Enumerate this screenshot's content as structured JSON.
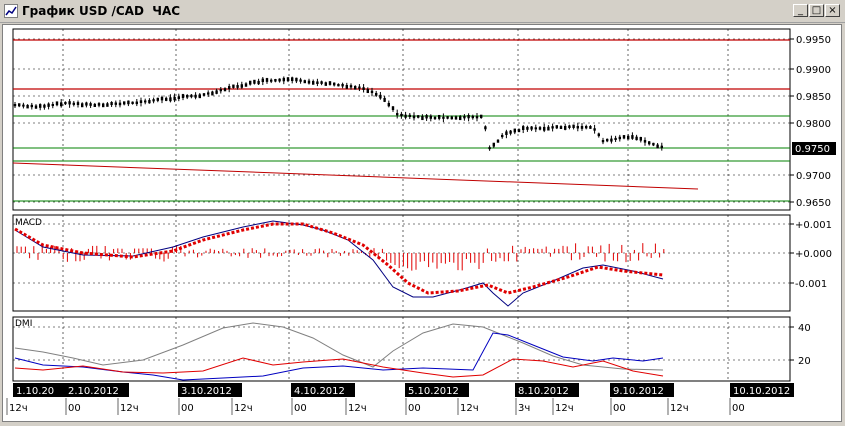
{
  "window": {
    "title": "График USD /CAD  ЧАС",
    "minimize_label": "_",
    "maximize_label": "□",
    "close_label": "×"
  },
  "price_panel": {
    "price_labels": [
      "0.9950",
      "0.9900",
      "0.9850",
      "0.9800",
      "0.9750",
      "0.9700",
      "0.9650"
    ],
    "current_price": "0.9750"
  },
  "macd_panel": {
    "title": "MACD",
    "labels": [
      "+0.001",
      "+0.000",
      "-0.001"
    ]
  },
  "dmi_panel": {
    "title": "DMI",
    "labels": [
      "40",
      "20"
    ]
  },
  "date_labels": [
    "1.10.20",
    "2.10.2012",
    "3.10.2012",
    "4.10.2012",
    "5.10.2012",
    "8.10.2012",
    "9.10.2012",
    "10.10.2012"
  ],
  "hour_labels": [
    "12ч",
    "00",
    "12ч",
    "00",
    "12ч",
    "00",
    "12ч",
    "00",
    "12ч",
    "3ч",
    "12ч",
    "00",
    "12ч",
    "00"
  ],
  "colors": {
    "bg": "#ffffff",
    "grid": "#000000",
    "red_level": "#c00000",
    "green_level": "#008000",
    "trend": "#c00000",
    "macd_line": "#000080",
    "signal_line": "#e00000",
    "histogram": "#e00000",
    "dmi_plus": "#0000c0",
    "dmi_minus": "#e00000",
    "adx": "#808080",
    "date_box_bg": "#000000",
    "date_box_text": "#ffffff"
  }
}
